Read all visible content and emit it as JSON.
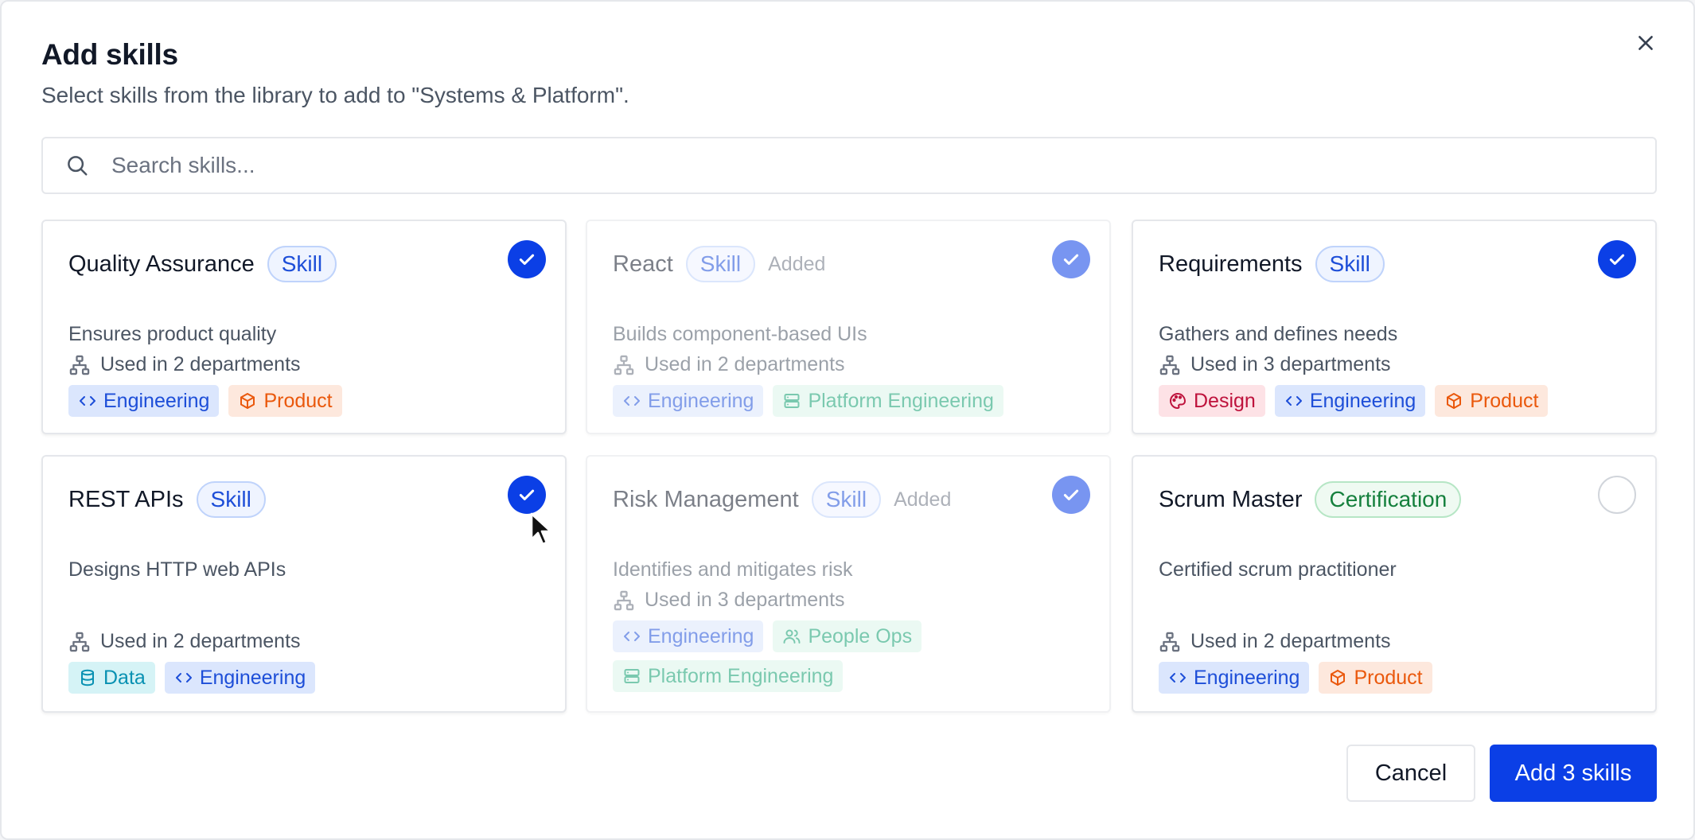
{
  "dialog": {
    "title": "Add skills",
    "subtitle": "Select skills from the library to add to \"Systems & Platform\".",
    "search": {
      "placeholder": "Search skills..."
    },
    "cancel_label": "Cancel",
    "primary_label": "Add 3 skills"
  },
  "cards": [
    {
      "name": "Quality Assurance",
      "badge": "Skill",
      "description": "Ensures product quality",
      "used": "Used in 2 departments",
      "selected": true,
      "added": false,
      "tags": [
        {
          "label": "Engineering",
          "icon": "code-icon"
        },
        {
          "label": "Product",
          "icon": "box-icon"
        }
      ]
    },
    {
      "name": "React",
      "badge": "Skill",
      "added_label": "Added",
      "description": "Builds component-based UIs",
      "used": "Used in 2 departments",
      "selected": true,
      "added": true,
      "tags": [
        {
          "label": "Engineering",
          "icon": "code-icon"
        },
        {
          "label": "Platform Engineering",
          "icon": "server-icon"
        }
      ]
    },
    {
      "name": "Requirements",
      "badge": "Skill",
      "description": "Gathers and defines needs",
      "used": "Used in 3 departments",
      "selected": true,
      "added": false,
      "tags": [
        {
          "label": "Design",
          "icon": "palette-icon"
        },
        {
          "label": "Engineering",
          "icon": "code-icon"
        },
        {
          "label": "Product",
          "icon": "box-icon"
        }
      ]
    },
    {
      "name": "REST APIs",
      "badge": "Skill",
      "description": "Designs HTTP web APIs",
      "used": "Used in 2 departments",
      "selected": true,
      "added": false,
      "tags": [
        {
          "label": "Data",
          "icon": "database-icon"
        },
        {
          "label": "Engineering",
          "icon": "code-icon"
        }
      ]
    },
    {
      "name": "Risk Management",
      "badge": "Skill",
      "added_label": "Added",
      "description": "Identifies and mitigates risk",
      "used": "Used in 3 departments",
      "selected": true,
      "added": true,
      "tags": [
        {
          "label": "Engineering",
          "icon": "code-icon"
        },
        {
          "label": "People Ops",
          "icon": "users-icon"
        },
        {
          "label": "Platform Engineering",
          "icon": "server-icon"
        }
      ]
    },
    {
      "name": "Scrum Master",
      "badge": "Certification",
      "description": "Certified scrum practitioner",
      "used": "Used in 2 departments",
      "selected": false,
      "added": false,
      "tags": [
        {
          "label": "Engineering",
          "icon": "code-icon"
        },
        {
          "label": "Product",
          "icon": "box-icon"
        }
      ]
    }
  ],
  "colors": {
    "primary": "#0b3fe6",
    "engineering_bg": "#dbe6fd",
    "engineering_fg": "#1d4ed8",
    "product_bg": "#fde8dd",
    "product_fg": "#ea580c",
    "design_bg": "#fde2e6",
    "design_fg": "#be123c",
    "data_bg": "#d5f3f6",
    "data_fg": "#0891b2",
    "platform_bg": "#dcf5ea",
    "platform_fg": "#0f9d6e"
  }
}
